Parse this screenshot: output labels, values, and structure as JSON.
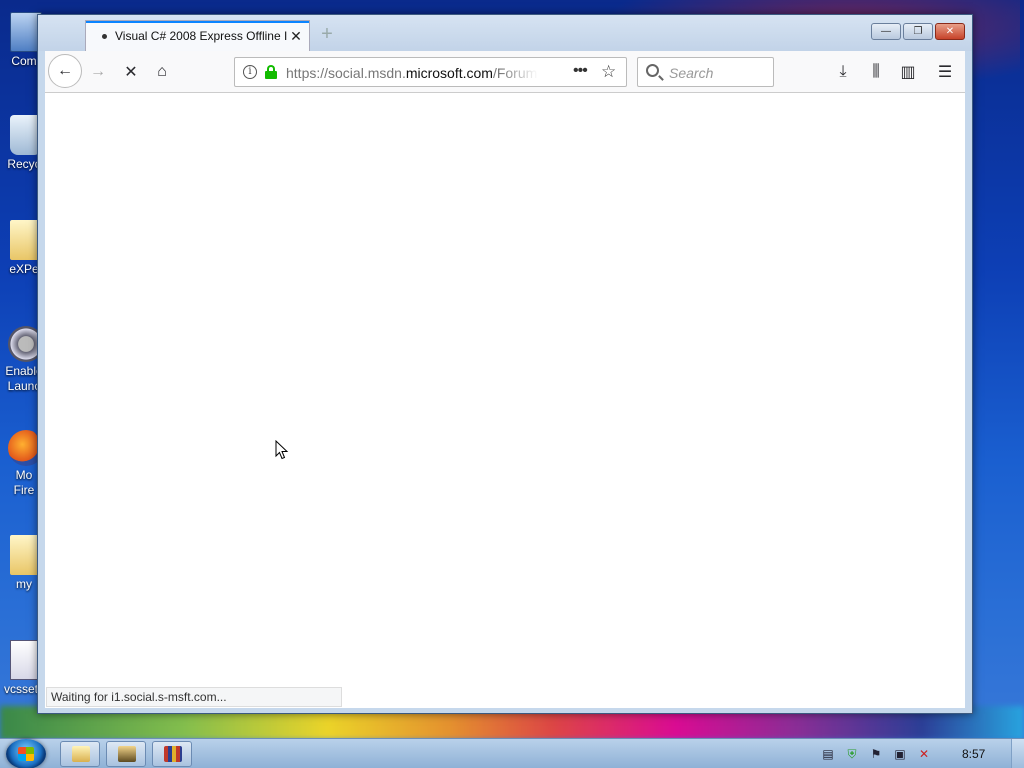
{
  "desktop": {
    "icons": [
      {
        "label": "Com"
      },
      {
        "label": "Recyc"
      },
      {
        "label": "eXPe"
      },
      {
        "label": "Enable"
      },
      {
        "label": "Launc"
      },
      {
        "label": "Mo"
      },
      {
        "label": "Fire"
      },
      {
        "label": "my"
      },
      {
        "label": "vcssetu"
      }
    ]
  },
  "browser": {
    "tab": {
      "title": "Visual C# 2008 Express Offline I",
      "close": "✕"
    },
    "new_tab": "+",
    "window_buttons": {
      "minimize": "—",
      "restore": "❐",
      "close": "✕"
    },
    "nav": {
      "back": "←",
      "forward": "→",
      "stop": "✕",
      "home": "⌂"
    },
    "url": {
      "prefix": "https://social.msdn.",
      "domain": "microsoft.com",
      "path": "/Forum",
      "page_actions": "•••",
      "bookmark": "☆"
    },
    "search": {
      "placeholder": "Search"
    },
    "toolbar": {
      "downloads": "⤓",
      "library": "⫼",
      "sidebar": "▥",
      "menu": "☰"
    },
    "status": "Waiting for i1.social.s-msft.com..."
  },
  "taskbar": {
    "clock": "8:57",
    "tray_icons": [
      "document-icon",
      "shield-icon",
      "flag-icon",
      "network-icon",
      "volume-muted-icon"
    ]
  }
}
